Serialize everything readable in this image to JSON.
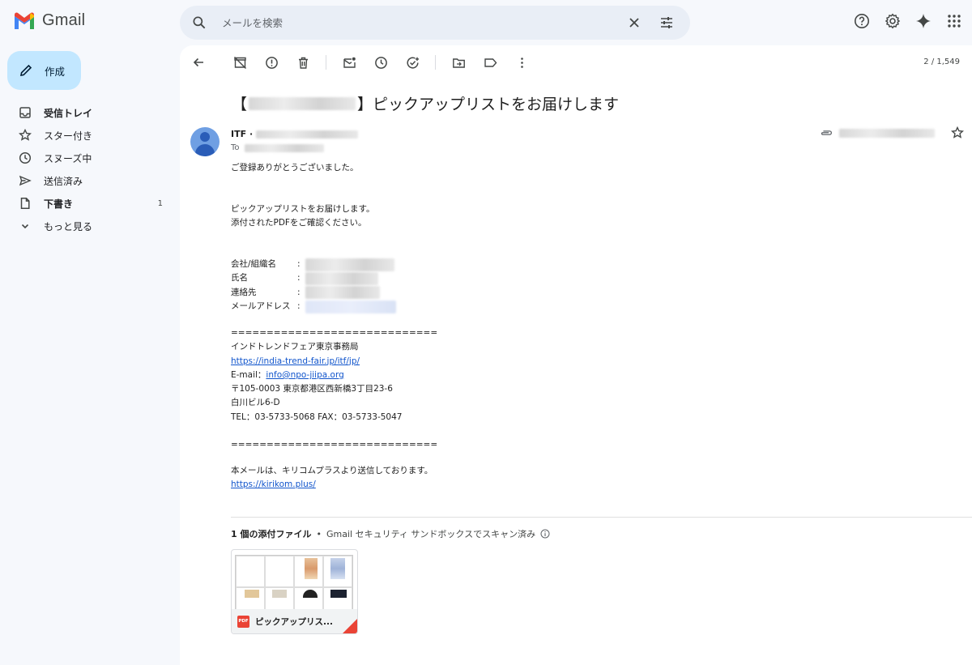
{
  "app": {
    "name": "Gmail"
  },
  "search": {
    "placeholder": "メールを検索"
  },
  "compose": {
    "label": "作成"
  },
  "nav": [
    {
      "label": "受信トレイ",
      "icon": "inbox-icon",
      "bold": true,
      "count": ""
    },
    {
      "label": "スター付き",
      "icon": "star-icon",
      "bold": false,
      "count": ""
    },
    {
      "label": "スヌーズ中",
      "icon": "clock-icon",
      "bold": false,
      "count": ""
    },
    {
      "label": "送信済み",
      "icon": "send-icon",
      "bold": false,
      "count": ""
    },
    {
      "label": "下書き",
      "icon": "draft-icon",
      "bold": true,
      "count": "1"
    },
    {
      "label": "もっと見る",
      "icon": "chevron-down-icon",
      "bold": false,
      "count": ""
    }
  ],
  "pager": "2 / 1,549",
  "email": {
    "subject_prefix": "【",
    "subject_suffix": "】ピックアップリストをお届けします",
    "sender_name": "ITF ·",
    "to_label": "To",
    "greeting": "ご登録ありがとうございました。",
    "intro_line1": "ピックアップリストをお届けします。",
    "intro_line2": "添付されたPDFをご確認ください。",
    "fields": {
      "company_label": "会社/組織名",
      "name_label": "氏名",
      "contact_label": "連絡先",
      "email_label": "メールアドレス",
      "colon": ":"
    },
    "separator": "=============================",
    "sig_org": "インドトレンドフェア東京事務局",
    "sig_url": "https://india-trend-fair.jp/itf/jp/",
    "sig_email_label": "E-mail：",
    "sig_email": "info@npo-jiipa.org",
    "sig_address": "〒105-0003 東京都港区西新橋3丁目23-6",
    "sig_building": "白川ビル6-D",
    "sig_tel": "TEL：03-5733-5068 FAX：03-5733-5047",
    "footer_note": "本メールは、キリコムプラスより送信しております。",
    "footer_url": "https://kirikom.plus/"
  },
  "attachments": {
    "heading": "1 個の添付ファイル",
    "dot": "•",
    "scan_note": "Gmail セキュリティ サンドボックスでスキャン済み",
    "file_name": "ピックアップリス...",
    "file_badge": "PDF"
  },
  "colors": {
    "accent": "#c2e7ff",
    "link": "#1155cc",
    "pdf_red": "#ea4335"
  }
}
